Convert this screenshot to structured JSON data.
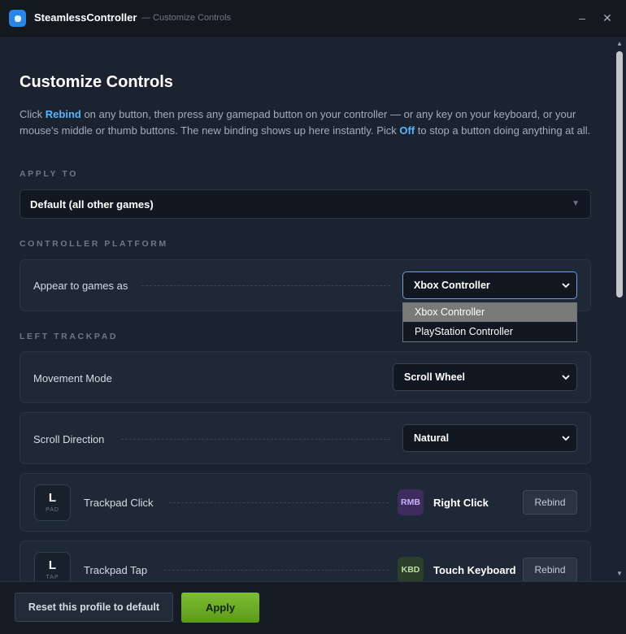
{
  "window": {
    "title": "SteamlessController",
    "subtitle": "— Customize Controls",
    "minimize_glyph": "–",
    "close_glyph": "✕"
  },
  "page": {
    "title": "Customize Controls",
    "intro_before_rebind": "Click ",
    "intro_rebind": "Rebind",
    "intro_middle": " on any button, then press any gamepad button on your controller — or any key on your keyboard, or your mouse's middle or thumb buttons. The new binding shows up here instantly. Pick ",
    "intro_off": "Off",
    "intro_after": " to stop a button doing anything at all."
  },
  "apply_to": {
    "section_label": "APPLY TO",
    "value": "Default (all other games)"
  },
  "platform": {
    "section_label": "CONTROLLER PLATFORM",
    "label": "Appear to games as",
    "value": "Xbox Controller",
    "options": [
      "Xbox Controller",
      "PlayStation Controller"
    ]
  },
  "left_trackpad": {
    "section_label": "LEFT TRACKPAD",
    "movement_mode": {
      "label": "Movement Mode",
      "value": "Scroll Wheel"
    },
    "scroll_direction": {
      "label": "Scroll Direction",
      "value": "Natural"
    },
    "bindings": [
      {
        "badge_letter": "L",
        "badge_sub": "PAD",
        "name": "Trackpad Click",
        "chip": "RMB",
        "action": "Right Click",
        "rebind_label": "Rebind"
      },
      {
        "badge_letter": "L",
        "badge_sub": "TAP",
        "name": "Trackpad Tap",
        "chip": "KBD",
        "action": "Touch Keyboard",
        "rebind_label": "Rebind"
      }
    ]
  },
  "footer": {
    "reset_label": "Reset this profile to default",
    "apply_label": "Apply"
  },
  "colors": {
    "accent_blue": "#56b6ff",
    "apply_green": "#6fae27",
    "background": "#1b2230"
  },
  "icons": {
    "app": "app-logo-icon",
    "select_caret": "chevron-down-icon",
    "apply_caret": "triangle-down-icon"
  }
}
